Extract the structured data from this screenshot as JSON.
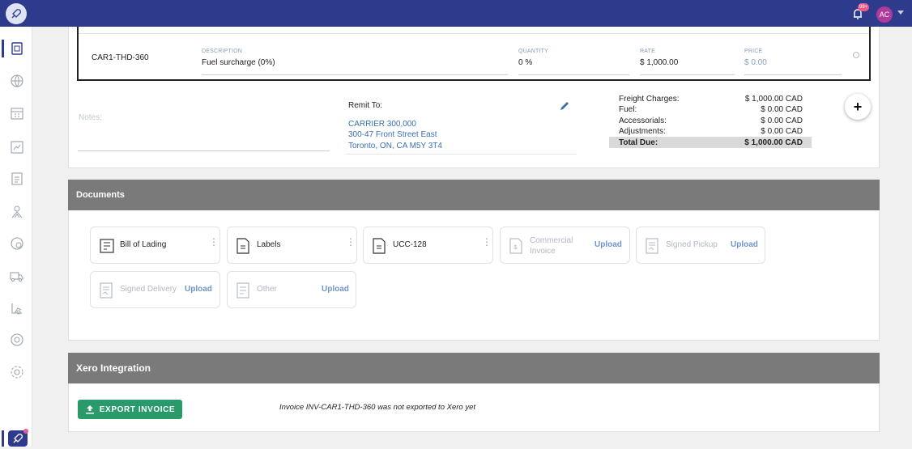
{
  "topbar": {
    "notification_badge": "99+",
    "avatar_initials": "AC"
  },
  "line_item": {
    "code": "CAR1-THD-360",
    "description_label": "DESCRIPTION",
    "description_value": "Fuel surcharge (0%)",
    "quantity_label": "QUANTITY",
    "quantity_value": "0 %",
    "rate_label": "RATE",
    "rate_value": "$ 1,000.00",
    "price_label": "PRICE",
    "price_value": "$ 0.00"
  },
  "notes": {
    "placeholder": "Notes:"
  },
  "remit": {
    "title": "Remit To:",
    "line1": "CARRIER 300,000",
    "line2": "300-47 Front Street East",
    "line3": "Toronto, ON, CA M5Y 3T4"
  },
  "totals": {
    "freight_label": "Freight Charges:",
    "freight_value": "$ 1,000.00 CAD",
    "fuel_label": "Fuel:",
    "fuel_value": "$ 0.00 CAD",
    "accessorials_label": "Accessorials:",
    "accessorials_value": "$ 0.00 CAD",
    "adjustments_label": "Adjustments:",
    "adjustments_value": "$ 0.00 CAD",
    "total_label": "Total Due:",
    "total_value": "$ 1,000.00 CAD"
  },
  "plus_label": "+",
  "documents": {
    "title": "Documents",
    "upload_label": "Upload",
    "items": [
      {
        "label": "Bill of Lading",
        "uploaded": true
      },
      {
        "label": "Labels",
        "uploaded": true
      },
      {
        "label": "UCC-128",
        "uploaded": true
      },
      {
        "label": "Commercial\nInvoice",
        "uploaded": false
      },
      {
        "label": "Signed Pickup",
        "uploaded": false
      },
      {
        "label": "Signed Delivery",
        "uploaded": false
      },
      {
        "label": "Other",
        "uploaded": false
      }
    ]
  },
  "xero": {
    "title": "Xero Integration",
    "export_label": "EXPORT INVOICE",
    "status_text": "Invoice INV-CAR1-THD-360 was not exported to Xero yet"
  },
  "colors": {
    "brand": "#2e3a8c",
    "accent_green": "#2a9a6b",
    "link_blue": "#3a6fb0",
    "header_gray": "#7a7a7a"
  }
}
